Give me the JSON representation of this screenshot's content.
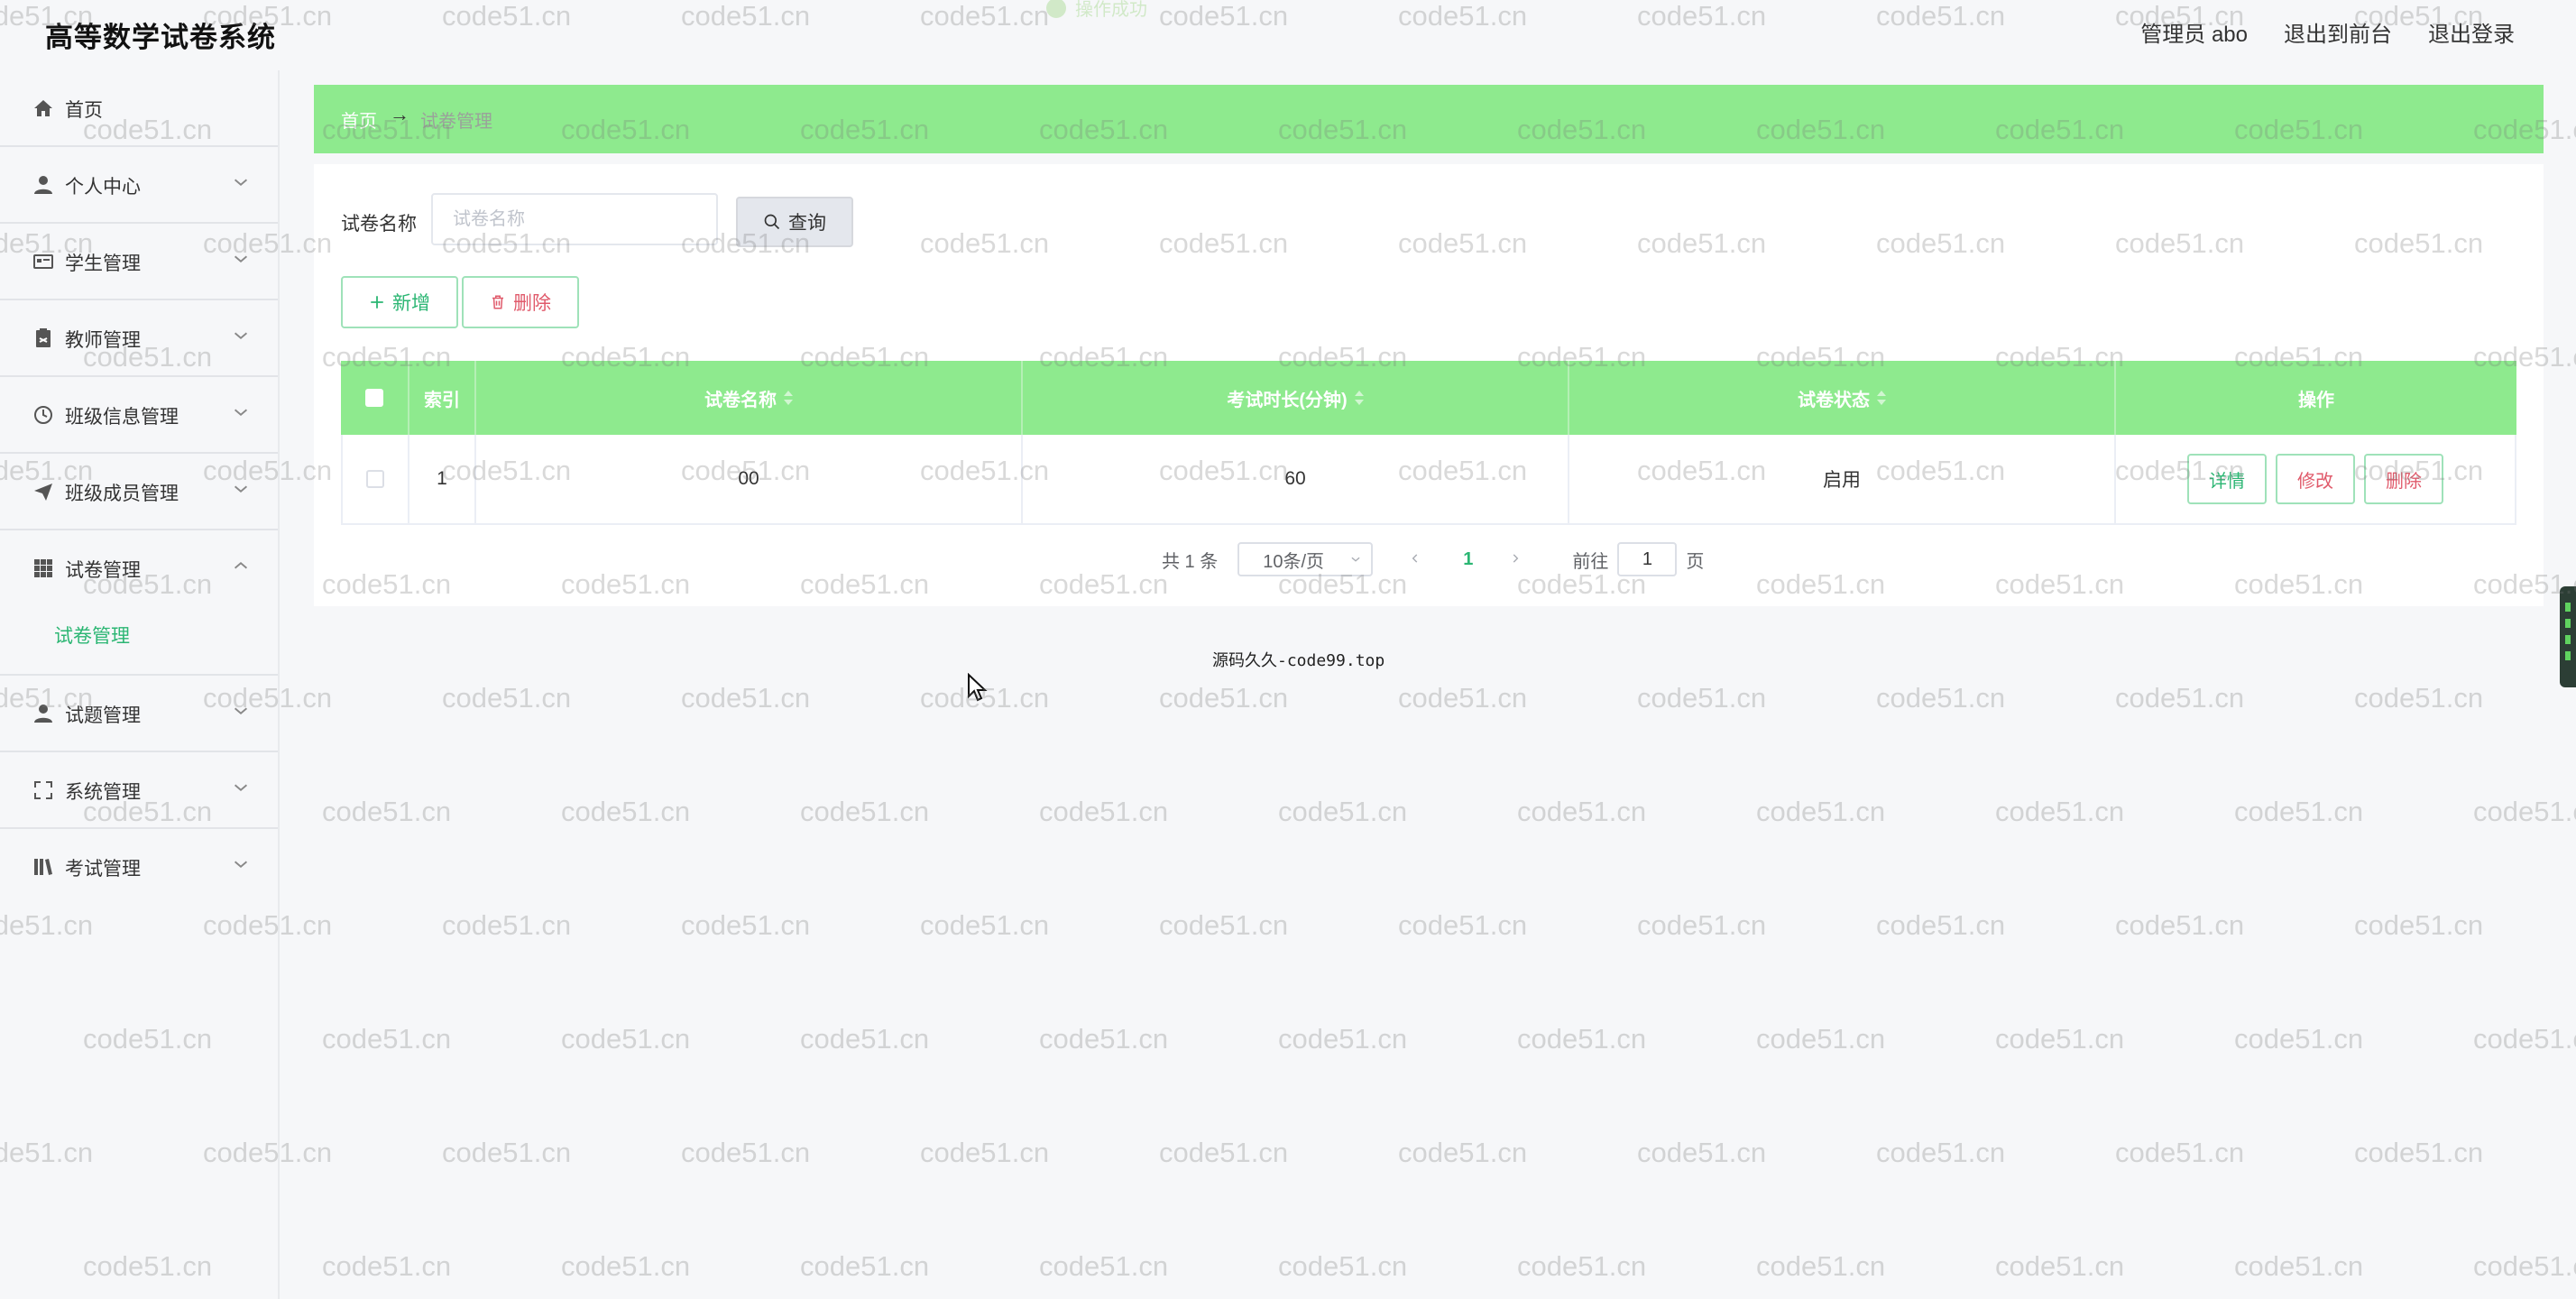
{
  "app": {
    "title": "高等数学试卷系统",
    "admin_label": "管理员 abo",
    "exit_front_label": "退出到前台",
    "logout_label": "退出登录",
    "toast_text": "操作成功"
  },
  "sidebar": {
    "items": [
      {
        "label": "首页",
        "icon": "home-icon",
        "expanded": false
      },
      {
        "label": "个人中心",
        "icon": "user-icon",
        "expanded": false
      },
      {
        "label": "学生管理",
        "icon": "id-card-icon",
        "expanded": false
      },
      {
        "label": "教师管理",
        "icon": "clipboard-icon",
        "expanded": false
      },
      {
        "label": "班级信息管理",
        "icon": "clock-icon",
        "expanded": false
      },
      {
        "label": "班级成员管理",
        "icon": "send-icon",
        "expanded": false
      },
      {
        "label": "试卷管理",
        "icon": "grid-icon",
        "expanded": true
      },
      {
        "label": "试题管理",
        "icon": "user-icon",
        "expanded": false
      },
      {
        "label": "系统管理",
        "icon": "fullscreen-icon",
        "expanded": false
      },
      {
        "label": "考试管理",
        "icon": "books-icon",
        "expanded": false
      }
    ],
    "submenu": {
      "label": "试卷管理"
    }
  },
  "breadcrumb": {
    "home": "首页",
    "separator": "→",
    "current": "试卷管理"
  },
  "search": {
    "label": "试卷名称",
    "placeholder": "试卷名称",
    "button_label": "查询"
  },
  "actions": {
    "add_label": "新增",
    "delete_label": "删除"
  },
  "table": {
    "columns": [
      "索引",
      "试卷名称",
      "考试时长(分钟)",
      "试卷状态",
      "操作"
    ],
    "rows": [
      {
        "index": "1",
        "name": "00",
        "duration": "60",
        "status": "启用"
      }
    ],
    "row_actions": {
      "detail": "详情",
      "edit": "修改",
      "delete": "删除"
    }
  },
  "pagination": {
    "total": "共 1 条",
    "page_size": "10条/页",
    "current_page": "1",
    "goto_label": "前往",
    "goto_value": "1",
    "page_unit": "页"
  },
  "footer": {
    "text": "源码久久-code99.top"
  },
  "watermark": {
    "text": "code51.cn"
  },
  "colors": {
    "accent_green": "#8eea8e",
    "primary_green": "#2bb673",
    "danger": "#e05a6b",
    "background": "#f6f7f9"
  }
}
